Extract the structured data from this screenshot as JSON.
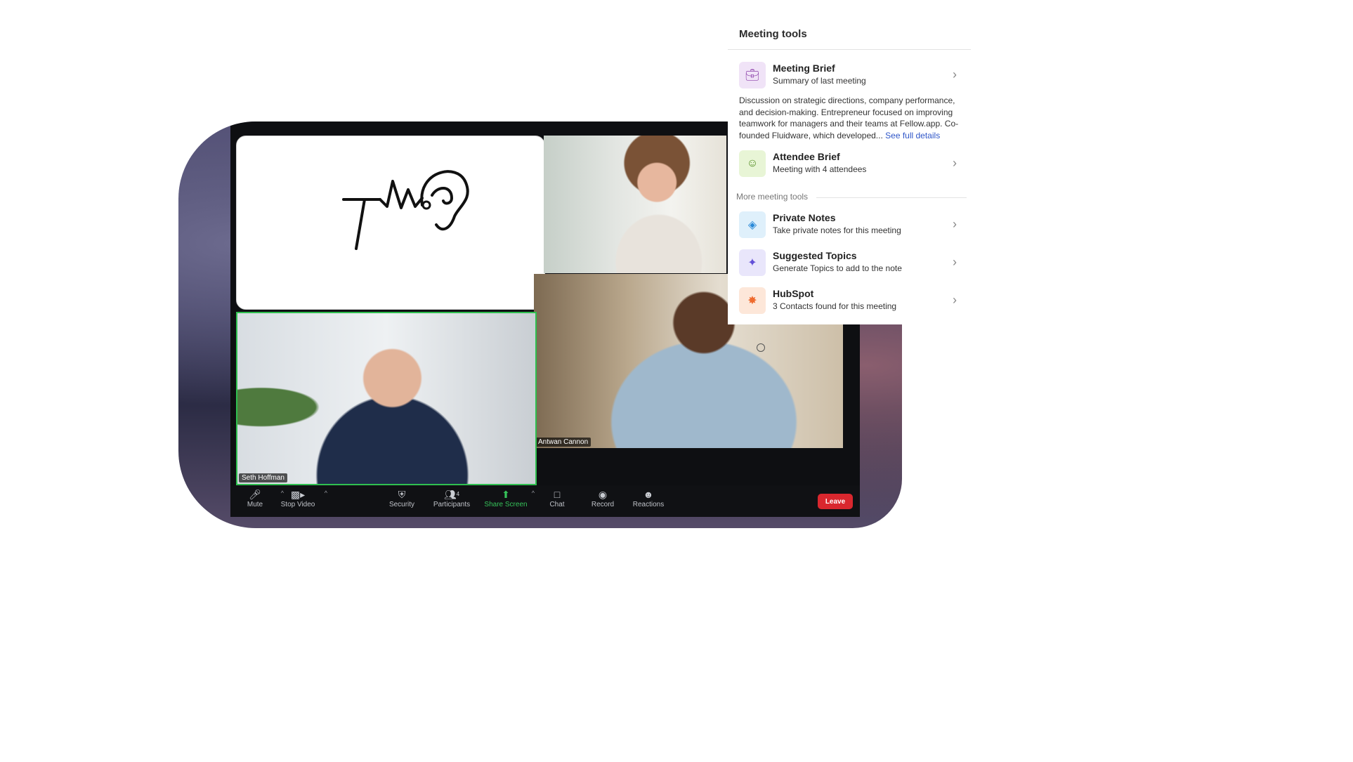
{
  "video": {
    "participants": [
      {
        "name": "Seth Hoffman"
      },
      {
        "name": "Antwan Cannon"
      }
    ],
    "toolbar": {
      "mute_label": "Mute",
      "stop_video_label": "Stop Video",
      "security_label": "Security",
      "participants_label": "Participants",
      "participants_count": "4",
      "share_screen_label": "Share Screen",
      "chat_label": "Chat",
      "record_label": "Record",
      "reactions_label": "Reactions",
      "leave_label": "Leave"
    },
    "accent_color": "#2fbf4f",
    "leave_color": "#d9272e"
  },
  "panel": {
    "title": "Meeting tools",
    "meeting_brief": {
      "title": "Meeting Brief",
      "subtitle": "Summary of last meeting",
      "icon": "briefcase-icon",
      "summary": "Discussion on strategic directions, company performance, and decision-making. Entrepreneur focused on improving teamwork for managers and their teams at Fellow.app. Co-founded Fluidware, which developed...",
      "link": "See full details"
    },
    "attendee_brief": {
      "title": "Attendee Brief",
      "subtitle": "Meeting with 4 attendees",
      "icon": "smiley-icon"
    },
    "more_label": "More meeting tools",
    "more_tools": [
      {
        "title": "Private Notes",
        "subtitle": "Take private notes for this meeting",
        "icon": "incognito-icon"
      },
      {
        "title": "Suggested Topics",
        "subtitle": "Generate Topics to add to the note",
        "icon": "sparkles-icon"
      },
      {
        "title": "HubSpot",
        "subtitle": "3 Contacts found for this meeting",
        "icon": "hubspot-icon"
      }
    ],
    "link_color": "#2f56c8"
  }
}
